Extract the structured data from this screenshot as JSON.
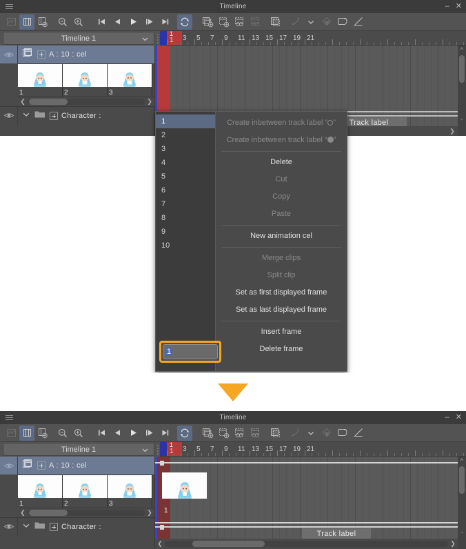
{
  "app": {
    "window_title": "Timeline",
    "minimize_label": "–",
    "close_label": "✕",
    "menu_icon": "hamburger-icon"
  },
  "toolbar": {
    "items": [
      {
        "name": "graph-editor-icon",
        "label": "Graph editor",
        "state": "disabled"
      },
      {
        "name": "enable-timeline-icon",
        "label": "Enable timeline",
        "state": "selected"
      },
      {
        "name": "new-timeline-icon",
        "label": "New timeline",
        "state": "normal"
      },
      {
        "name": "zoom-out-icon",
        "label": "Zoom out",
        "state": "normal"
      },
      {
        "name": "zoom-in-icon",
        "label": "Zoom in",
        "state": "normal"
      },
      {
        "name": "go-to-start-icon",
        "label": "Go to start",
        "state": "normal"
      },
      {
        "name": "previous-frame-icon",
        "label": "Previous frame",
        "state": "normal"
      },
      {
        "name": "play-icon",
        "label": "Play / Stop",
        "state": "normal"
      },
      {
        "name": "next-frame-icon",
        "label": "Next frame",
        "state": "normal"
      },
      {
        "name": "go-to-end-icon",
        "label": "Go to end",
        "state": "normal"
      },
      {
        "name": "loop-playback-icon",
        "label": "Loop playback",
        "state": "selected"
      },
      {
        "name": "new-animation-cel-icon",
        "label": "New animation cel",
        "state": "normal"
      },
      {
        "name": "new-layer-icon",
        "label": "New layer",
        "state": "normal"
      },
      {
        "name": "specify-cels-icon",
        "label": "Specify cels",
        "state": "normal"
      },
      {
        "name": "duplicate-cel-icon",
        "label": "Duplicate cel",
        "state": "disabled"
      },
      {
        "name": "copy-frame-icon",
        "label": "Copy frame",
        "state": "normal"
      },
      {
        "name": "onion-skin-icon",
        "label": "Enable onion skin",
        "state": "disabled"
      },
      {
        "name": "chevron-down-icon",
        "label": "Onion skin settings",
        "state": "normal"
      },
      {
        "name": "delete-cel-icon",
        "label": "Delete cel",
        "state": "disabled"
      },
      {
        "name": "light-table-icon",
        "label": "Light table",
        "state": "normal"
      },
      {
        "name": "edit-track-icon",
        "label": "Edit track",
        "state": "normal"
      }
    ]
  },
  "timeline_selector": {
    "value": "Timeline 1",
    "chevron": "chevron-down-icon"
  },
  "ruler": {
    "playhead_frame": "1",
    "playhead_label_top": "1",
    "numbers": [
      "3",
      "5",
      "7",
      "9",
      "11",
      "13",
      "15",
      "17",
      "19",
      "21"
    ]
  },
  "layers": {
    "animation_folder": {
      "label": "A : 10 : cel",
      "eye_icon": "eye-icon",
      "folder_icon": "animation-folder-icon",
      "expand_icon": "plus-box-icon",
      "selected": true
    },
    "character_folder": {
      "label": "Character :",
      "eye_icon": "eye-icon",
      "collapse_icon": "chevron-down-icon",
      "folder_icon": "folder-icon",
      "expand_icon": "plus-box-icon"
    },
    "cel_thumbnails": [
      {
        "number": "1"
      },
      {
        "number": "2"
      },
      {
        "number": "3"
      }
    ],
    "scroll_left_icon": "chevron-left-icon",
    "scroll_right_icon": "chevron-right-icon"
  },
  "context_menu": {
    "frame_numbers": [
      "1",
      "2",
      "3",
      "4",
      "5",
      "6",
      "7",
      "8",
      "9",
      "10"
    ],
    "selected_frame_number": "1",
    "items": [
      {
        "label": "Create inbetween track label “",
        "glyph": "circle-outline",
        "label_after": "”",
        "state": "disabled"
      },
      {
        "label": "Create inbetween track label “",
        "glyph": "circle-filled",
        "label_after": "”",
        "state": "disabled"
      },
      {
        "separator": true
      },
      {
        "label": "Delete",
        "state": "enabled"
      },
      {
        "label": "Cut",
        "state": "disabled"
      },
      {
        "label": "Copy",
        "state": "disabled"
      },
      {
        "label": "Paste",
        "state": "disabled"
      },
      {
        "separator": true
      },
      {
        "label": "New animation cel",
        "state": "enabled"
      },
      {
        "separator": true
      },
      {
        "label": "Merge clips",
        "state": "disabled"
      },
      {
        "label": "Split clip",
        "state": "disabled"
      },
      {
        "label": "Set as first displayed frame",
        "state": "enabled"
      },
      {
        "label": "Set as last displayed frame",
        "state": "enabled"
      },
      {
        "separator": true
      },
      {
        "label": "Insert frame",
        "state": "enabled"
      },
      {
        "label": "Delete frame",
        "state": "enabled"
      }
    ],
    "frame_input": {
      "value": "1",
      "highlight_color": "#f5a623"
    }
  },
  "arrow": {
    "name": "down-arrow",
    "color": "#f5a623"
  },
  "bottom_panel": {
    "cel_number": "1",
    "track_label_button": "Track label",
    "track_label_chevron": "chevron-down-icon"
  },
  "colors": {
    "accent_orange": "#f5a623",
    "playhead_red": "#b73a3a",
    "playhead_blue": "#3a43c9",
    "selection_blue": "#6d7a93",
    "panel_bg": "#535353",
    "track_bg": "#5a5a5a"
  }
}
